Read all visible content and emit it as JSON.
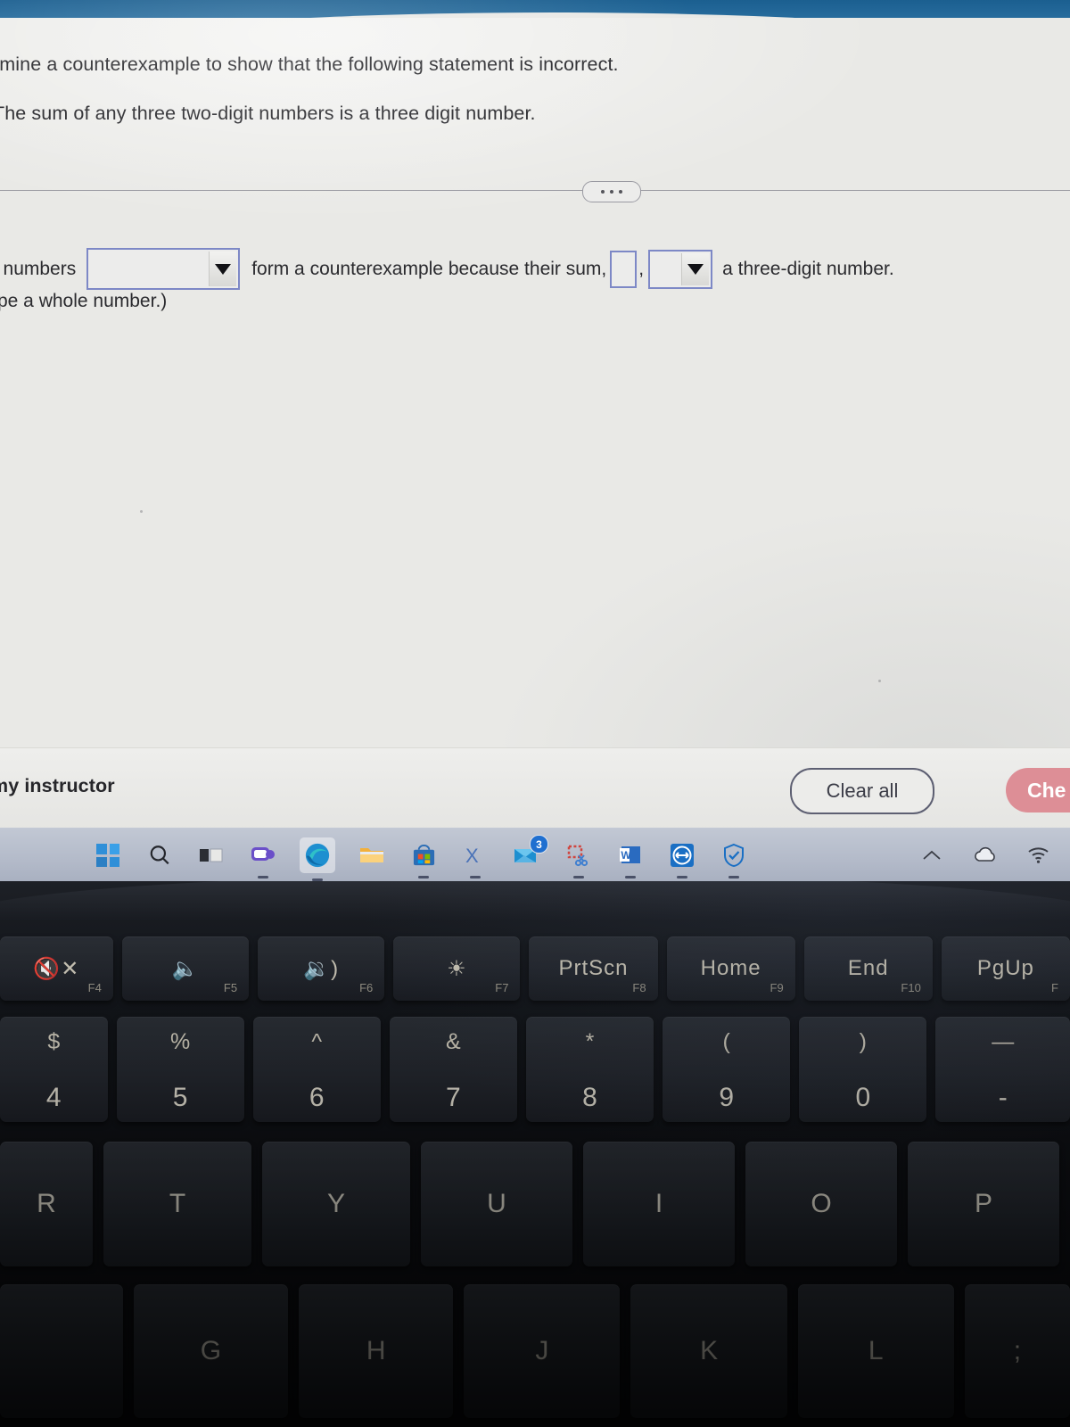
{
  "question": {
    "instruction": "rmine a counterexample to show that the following statement is incorrect.",
    "statement": "The sum of any three two-digit numbers is a three digit number."
  },
  "divider": {
    "overflow_icon": "ellipsis-icon"
  },
  "answer": {
    "fragment_1": "e numbers",
    "dropdown_1": {
      "value": "",
      "icon": "chevron-down-icon"
    },
    "fragment_2": "form a counterexample because their sum,",
    "sum_input": {
      "value": ""
    },
    "comma": ",",
    "dropdown_2": {
      "value": "",
      "icon": "chevron-down-icon"
    },
    "fragment_3": "a three-digit number.",
    "hint": "rpe a whole number.)"
  },
  "actions": {
    "ask_instructor": "my instructor",
    "clear_all": "Clear all",
    "check_answer": "Che",
    "check_answer_color": "#dd8e96"
  },
  "taskbar": {
    "items": [
      {
        "name": "start-button",
        "icon": "windows-logo-icon",
        "label": "Start"
      },
      {
        "name": "search-button",
        "icon": "search-icon",
        "label": "Search"
      },
      {
        "name": "task-view-button",
        "icon": "task-view-icon",
        "label": "Task View"
      },
      {
        "name": "teams-button",
        "icon": "teams-chat-icon",
        "label": "Chat"
      },
      {
        "name": "edge-button",
        "icon": "edge-icon",
        "label": "Microsoft Edge"
      },
      {
        "name": "file-explorer-button",
        "icon": "folder-icon",
        "label": "File Explorer"
      },
      {
        "name": "microsoft-store-button",
        "icon": "store-icon",
        "label": "Microsoft Store"
      },
      {
        "name": "excel-button",
        "icon": "excel-icon",
        "label": "Excel"
      },
      {
        "name": "mail-button",
        "icon": "mail-icon",
        "label": "Mail",
        "badge": "3"
      },
      {
        "name": "snipping-tool-button",
        "icon": "snipping-tool-icon",
        "label": "Snipping Tool"
      },
      {
        "name": "word-button",
        "icon": "word-icon",
        "label": "Word"
      },
      {
        "name": "teamviewer-button",
        "icon": "teamviewer-icon",
        "label": "TeamViewer"
      },
      {
        "name": "security-button",
        "icon": "shield-check-icon",
        "label": "Windows Security"
      }
    ],
    "tray": [
      {
        "name": "show-hidden-icons",
        "icon": "chevron-up-icon"
      },
      {
        "name": "onedrive-icon",
        "icon": "cloud-icon"
      },
      {
        "name": "network-icon",
        "icon": "wifi-icon"
      }
    ]
  },
  "keyboard": {
    "function_row": [
      {
        "glyph": "␃",
        "icon": "mute-icon",
        "fn": "F4"
      },
      {
        "glyph": "␃",
        "icon": "volume-down-icon",
        "fn": "F5"
      },
      {
        "glyph": "␃",
        "icon": "volume-up-icon",
        "fn": "F6"
      },
      {
        "glyph": "☀",
        "icon": "keyboard-backlight-icon",
        "fn": "F7"
      },
      {
        "glyph": "PrtScn",
        "icon": "print-screen-icon",
        "fn": "F8"
      },
      {
        "glyph": "Home",
        "icon": "home-key-icon",
        "fn": "F9"
      },
      {
        "glyph": "End",
        "icon": "end-key-icon",
        "fn": "F10"
      },
      {
        "glyph": "PgUp",
        "icon": "page-up-icon",
        "fn": "F"
      }
    ],
    "number_row": [
      {
        "top": "$",
        "bottom": "4"
      },
      {
        "top": "%",
        "bottom": "5"
      },
      {
        "top": "^",
        "bottom": "6"
      },
      {
        "top": "&",
        "bottom": "7"
      },
      {
        "top": "*",
        "bottom": "8"
      },
      {
        "top": "(",
        "bottom": "9"
      },
      {
        "top": ")",
        "bottom": "0"
      },
      {
        "top": "—",
        "bottom": "-"
      }
    ],
    "letter_row_1": [
      "R",
      "T",
      "Y",
      "U",
      "I",
      "O",
      "P"
    ],
    "letter_row_2": [
      "",
      "G",
      "H",
      "J",
      "K",
      "L",
      ";"
    ]
  }
}
